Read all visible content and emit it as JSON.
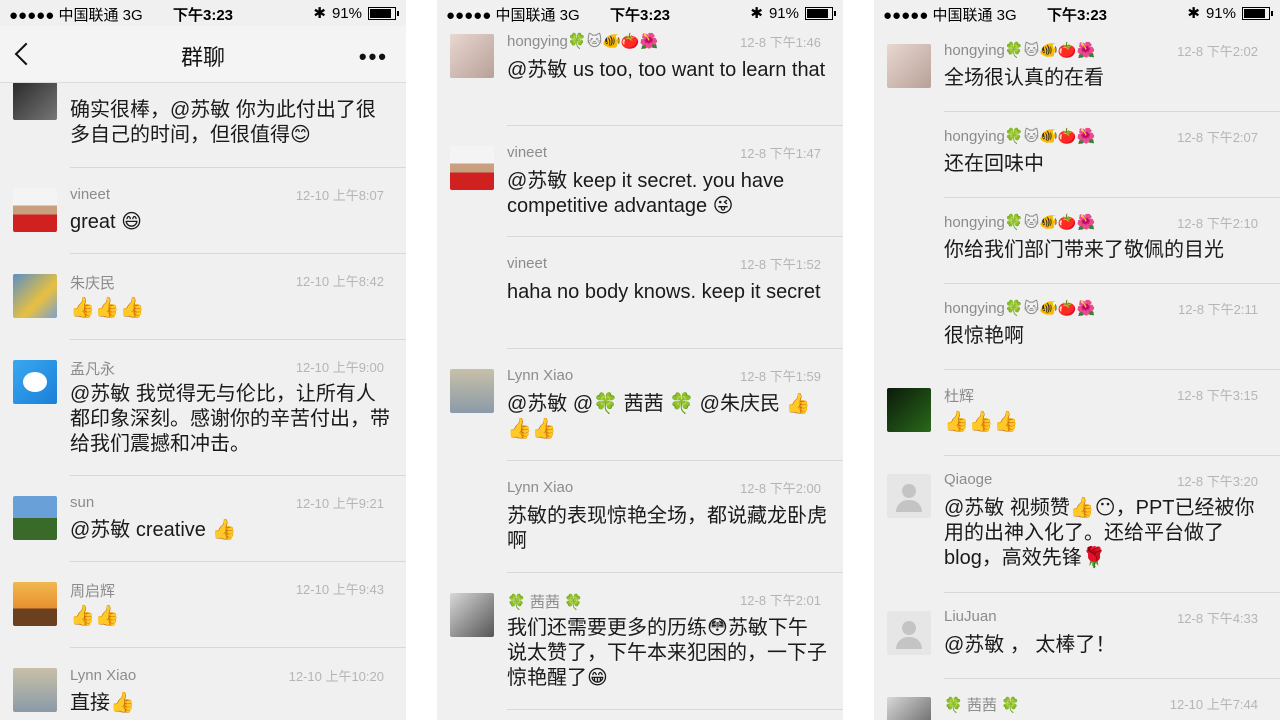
{
  "status": {
    "signal": "●●●●● 中国联通  3G",
    "time": "下午3:23",
    "battery": "91%",
    "battery_level": 0.91
  },
  "nav": {
    "title": "群聊",
    "more": "•••"
  },
  "screens": [
    {
      "messages": [
        {
          "sender": "",
          "time": "",
          "text": "确实很棒，@苏敏 你为此付出了很多自己的时间，但很值得😊"
        },
        {
          "sender": "vineet",
          "time": "12-10 上午8:07",
          "text": "great 😄"
        },
        {
          "sender": "朱庆民",
          "time": "12-10 上午8:42",
          "text": "👍👍👍"
        },
        {
          "sender": "孟凡永",
          "time": "12-10 上午9:00",
          "text": "@苏敏 我觉得无与伦比，让所有人都印象深刻。感谢你的辛苦付出，带给我们震撼和冲击。"
        },
        {
          "sender": "sun",
          "time": "12-10 上午9:21",
          "text": "@苏敏 creative 👍"
        },
        {
          "sender": "周启辉",
          "time": "12-10 上午9:43",
          "text": "👍👍"
        },
        {
          "sender": "Lynn Xiao",
          "time": "12-10 上午10:20",
          "text": "直接👍"
        }
      ]
    },
    {
      "messages": [
        {
          "sender": "hongying🍀🐱🐠🍅🌺",
          "time": "12-8 下午1:46",
          "text": "@苏敏 us too, too want to learn that"
        },
        {
          "sender": "vineet",
          "time": "12-8 下午1:47",
          "text": "@苏敏 keep it secret. you have competitive  advantage 😜"
        },
        {
          "sender": "vineet",
          "time": "12-8 下午1:52",
          "text": "haha no body knows. keep it secret"
        },
        {
          "sender": "Lynn Xiao",
          "time": "12-8 下午1:59",
          "text": "@苏敏 @🍀 茜茜  🍀 @朱庆民 👍👍👍"
        },
        {
          "sender": "Lynn Xiao",
          "time": "12-8 下午2:00",
          "text": "苏敏的表现惊艳全场，都说藏龙卧虎啊"
        },
        {
          "sender": "🍀 茜茜  🍀",
          "time": "12-8 下午2:01",
          "text": "我们还需要更多的历练😳苏敏下午说太赞了，下午本来犯困的，一下子惊艳醒了😁"
        }
      ]
    },
    {
      "messages": [
        {
          "sender": "hongying🍀🐱🐠🍅🌺",
          "time": "12-8 下午2:02",
          "text": "全场很认真的在看"
        },
        {
          "sender": "hongying🍀🐱🐠🍅🌺",
          "time": "12-8 下午2:07",
          "text": "还在回味中"
        },
        {
          "sender": "hongying🍀🐱🐠🍅🌺",
          "time": "12-8 下午2:10",
          "text": "你给我们部门带来了敬佩的目光"
        },
        {
          "sender": "hongying🍀🐱🐠🍅🌺",
          "time": "12-8 下午2:11",
          "text": "很惊艳啊"
        },
        {
          "sender": "杜辉",
          "time": "12-8 下午3:15",
          "text": "👍👍👍"
        },
        {
          "sender": "Qiaoge",
          "time": "12-8 下午3:20",
          "text": "@苏敏 视频赞👍😶，PPT已经被你用的出神入化了。还给平台做了blog，高效先锋🌹"
        },
        {
          "sender": "LiuJuan",
          "time": "12-8 下午4:33",
          "text": "@苏敏 ， 太棒了！"
        },
        {
          "sender": "🍀 茜茜  🍀",
          "time": "12-10 上午7:44",
          "text": ""
        }
      ]
    }
  ]
}
